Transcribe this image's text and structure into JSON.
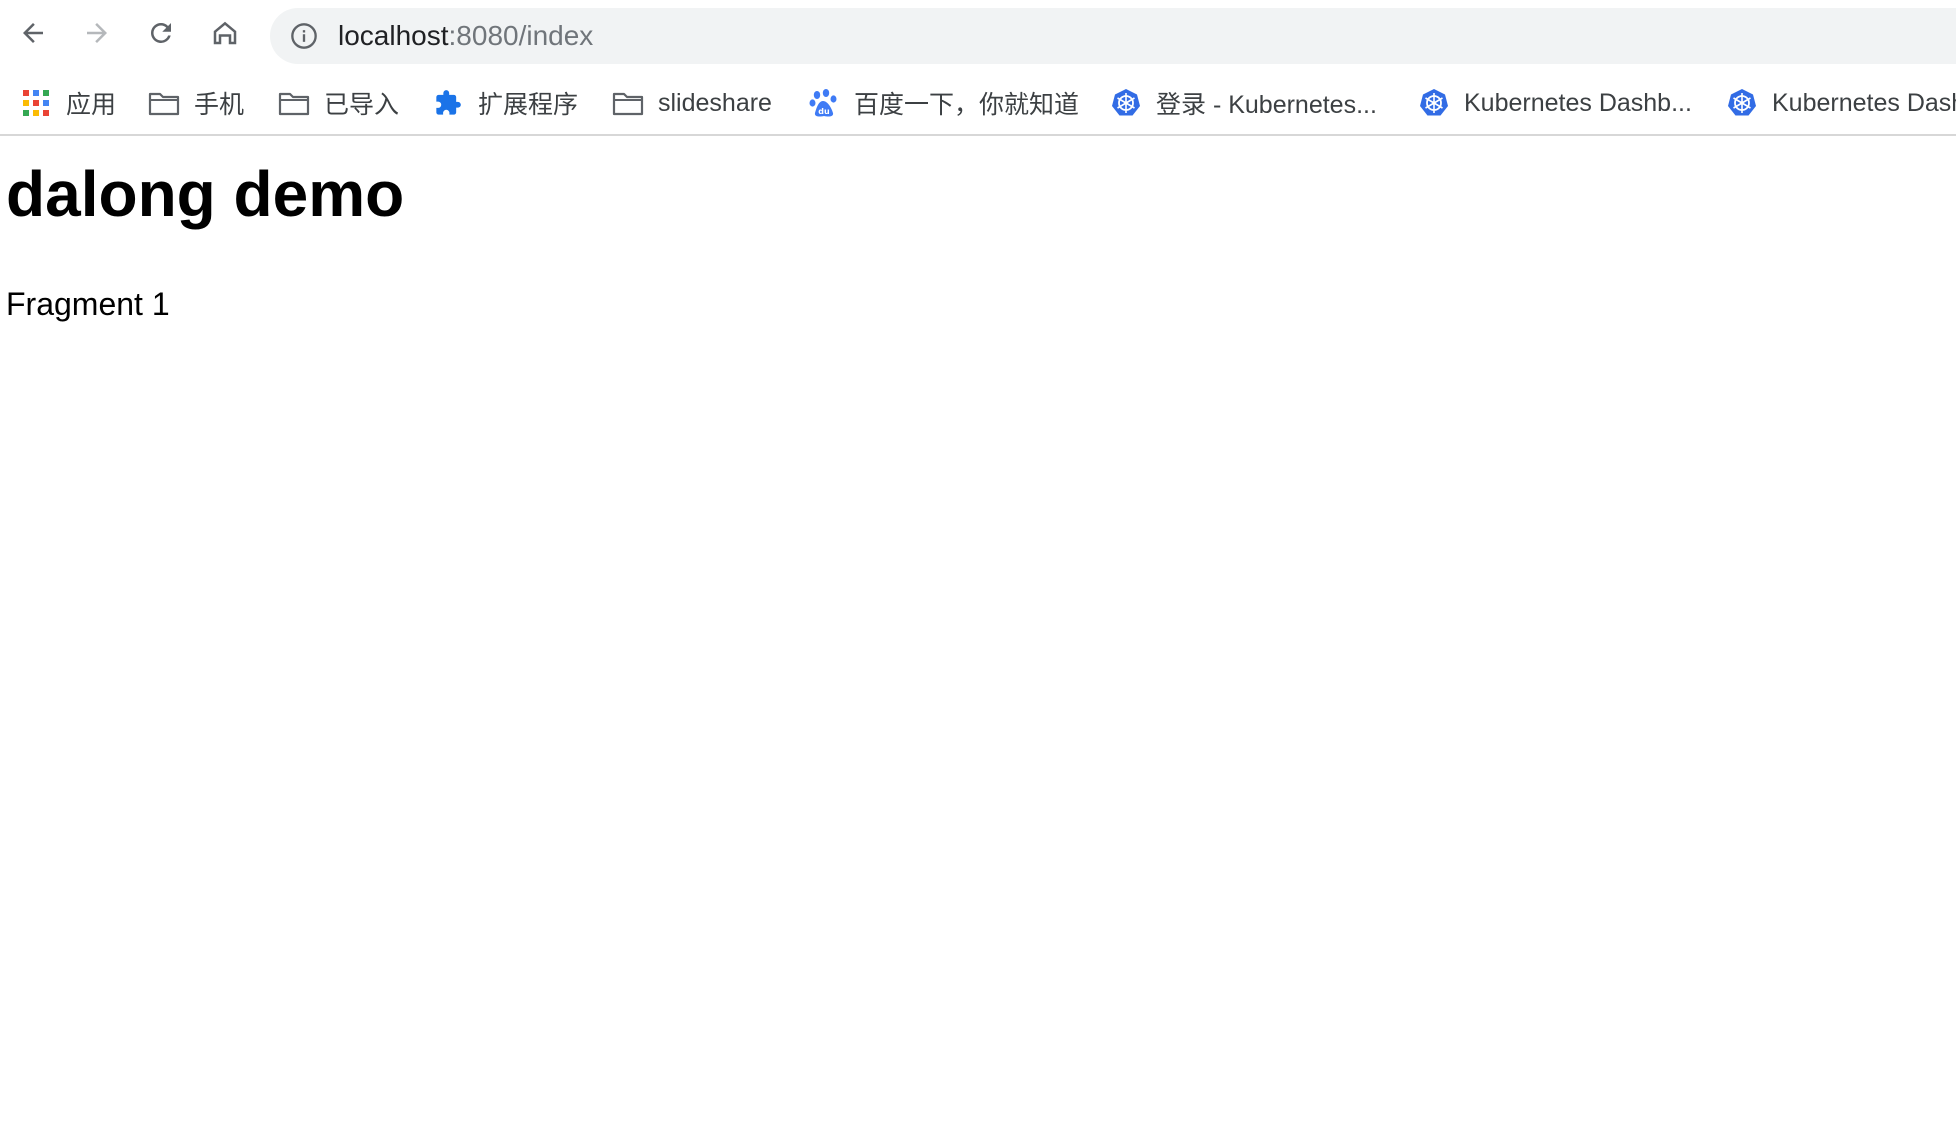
{
  "browser": {
    "url_host": "localhost",
    "url_path": ":8080/index"
  },
  "bookmarks": {
    "items": [
      {
        "label": "应用",
        "icon": "apps-grid-icon"
      },
      {
        "label": "手机",
        "icon": "folder-icon"
      },
      {
        "label": "已导入",
        "icon": "folder-icon"
      },
      {
        "label": "扩展程序",
        "icon": "puzzle-icon"
      },
      {
        "label": "slideshare",
        "icon": "folder-icon"
      },
      {
        "label": "百度一下，你就知道",
        "icon": "baidu-paw-icon"
      },
      {
        "label": "登录 - Kubernetes...",
        "icon": "kubernetes-icon"
      },
      {
        "label": "Kubernetes Dashb...",
        "icon": "kubernetes-icon"
      },
      {
        "label": "Kubernetes Dash",
        "icon": "kubernetes-icon"
      }
    ]
  },
  "page": {
    "heading": "dalong demo",
    "fragment": "Fragment 1"
  },
  "colors": {
    "kubernetes_blue": "#326ce5",
    "extension_blue": "#1a73e8",
    "omnibox_bg": "#f1f3f4"
  }
}
